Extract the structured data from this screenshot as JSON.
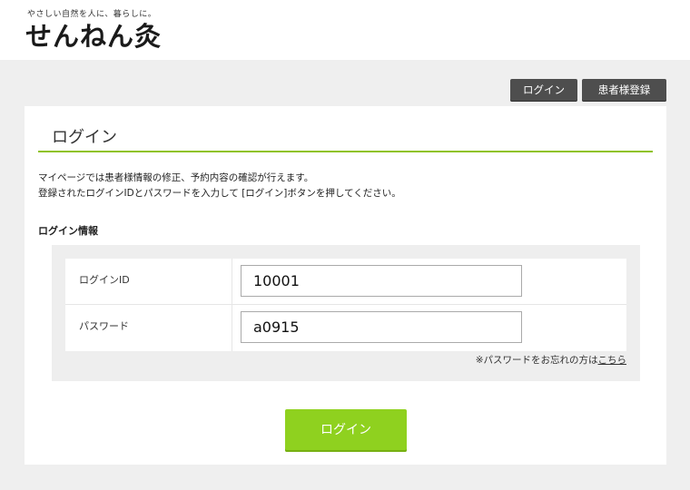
{
  "header": {
    "tagline": "やさしい自然を人に、暮らしに。",
    "logo": "せんねん灸"
  },
  "top_buttons": {
    "login": "ログイン",
    "register": "患者様登録"
  },
  "card": {
    "title": "ログイン",
    "intro_line1": "マイページでは患者様情報の修正、予約内容の確認が行えます。",
    "intro_line2": "登録されたログインIDとパスワードを入力して [ログイン]ボタンを押してください。",
    "section_label": "ログイン情報"
  },
  "form": {
    "login_id_label": "ログインID",
    "login_id_value": "10001",
    "password_label": "パスワード",
    "password_value": "a0915",
    "forgot_text": "※パスワードをお忘れの方は",
    "forgot_link": "こちら"
  },
  "submit": {
    "label": "ログイン"
  },
  "colors": {
    "accent": "#8fc31f",
    "button_green": "#8fd11f",
    "dark_button": "#4e4e4e"
  }
}
